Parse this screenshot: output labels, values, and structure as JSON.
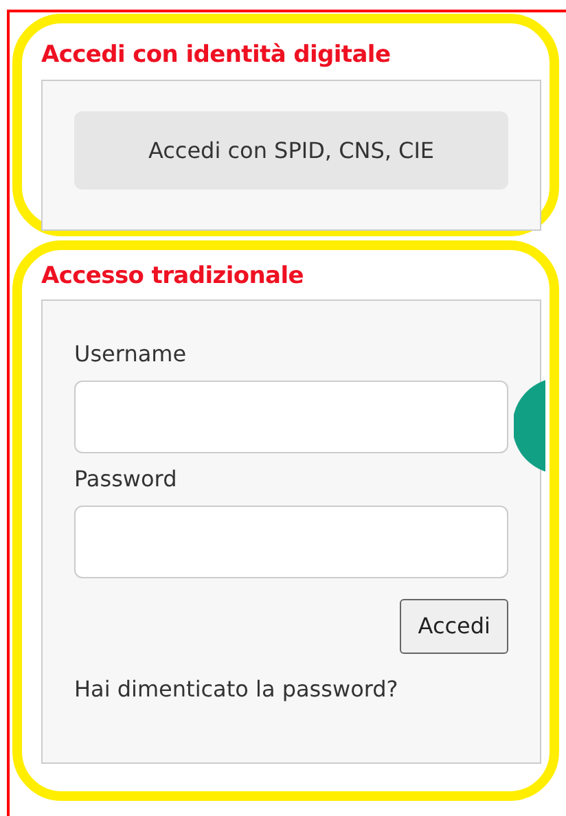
{
  "digital_login": {
    "heading": "Accedi con identità digitale",
    "button": "Accedi con SPID, CNS, CIE"
  },
  "traditional_login": {
    "heading": "Accesso tradizionale",
    "fields": [
      {
        "label": "Username"
      },
      {
        "label": "Password"
      }
    ],
    "submit": "Accedi",
    "forgot_link": "Hai dimenticato la password?"
  }
}
